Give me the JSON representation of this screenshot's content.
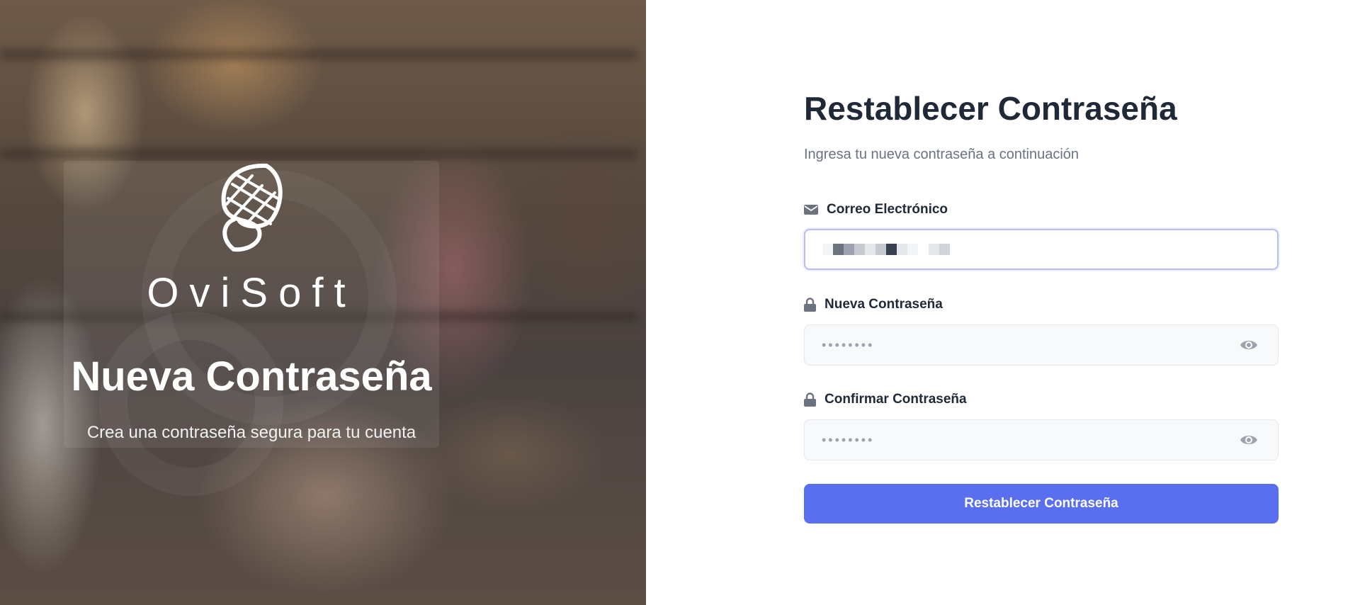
{
  "hero": {
    "brand_name": "OviSoft",
    "title": "Nueva Contraseña",
    "subtitle": "Crea una contraseña segura para tu cuenta"
  },
  "form": {
    "title": "Restablecer Contraseña",
    "subtitle": "Ingresa tu nueva contraseña a continuación",
    "email": {
      "label": "Correo Electrónico",
      "icon": "envelope-icon",
      "value_redacted": true
    },
    "new_password": {
      "label": "Nueva Contraseña",
      "icon": "lock-icon",
      "placeholder": "••••••••",
      "toggle_icon": "eye-icon"
    },
    "confirm_password": {
      "label": "Confirmar Contraseña",
      "icon": "lock-icon",
      "placeholder": "••••••••",
      "toggle_icon": "eye-icon"
    },
    "submit_label": "Restablecer Contraseña"
  },
  "colors": {
    "primary": "#5a6ff0",
    "title": "#1f2937",
    "muted": "#6b7280",
    "field_bg": "#f8f9fb",
    "focus_border": "#b6bdf7"
  }
}
